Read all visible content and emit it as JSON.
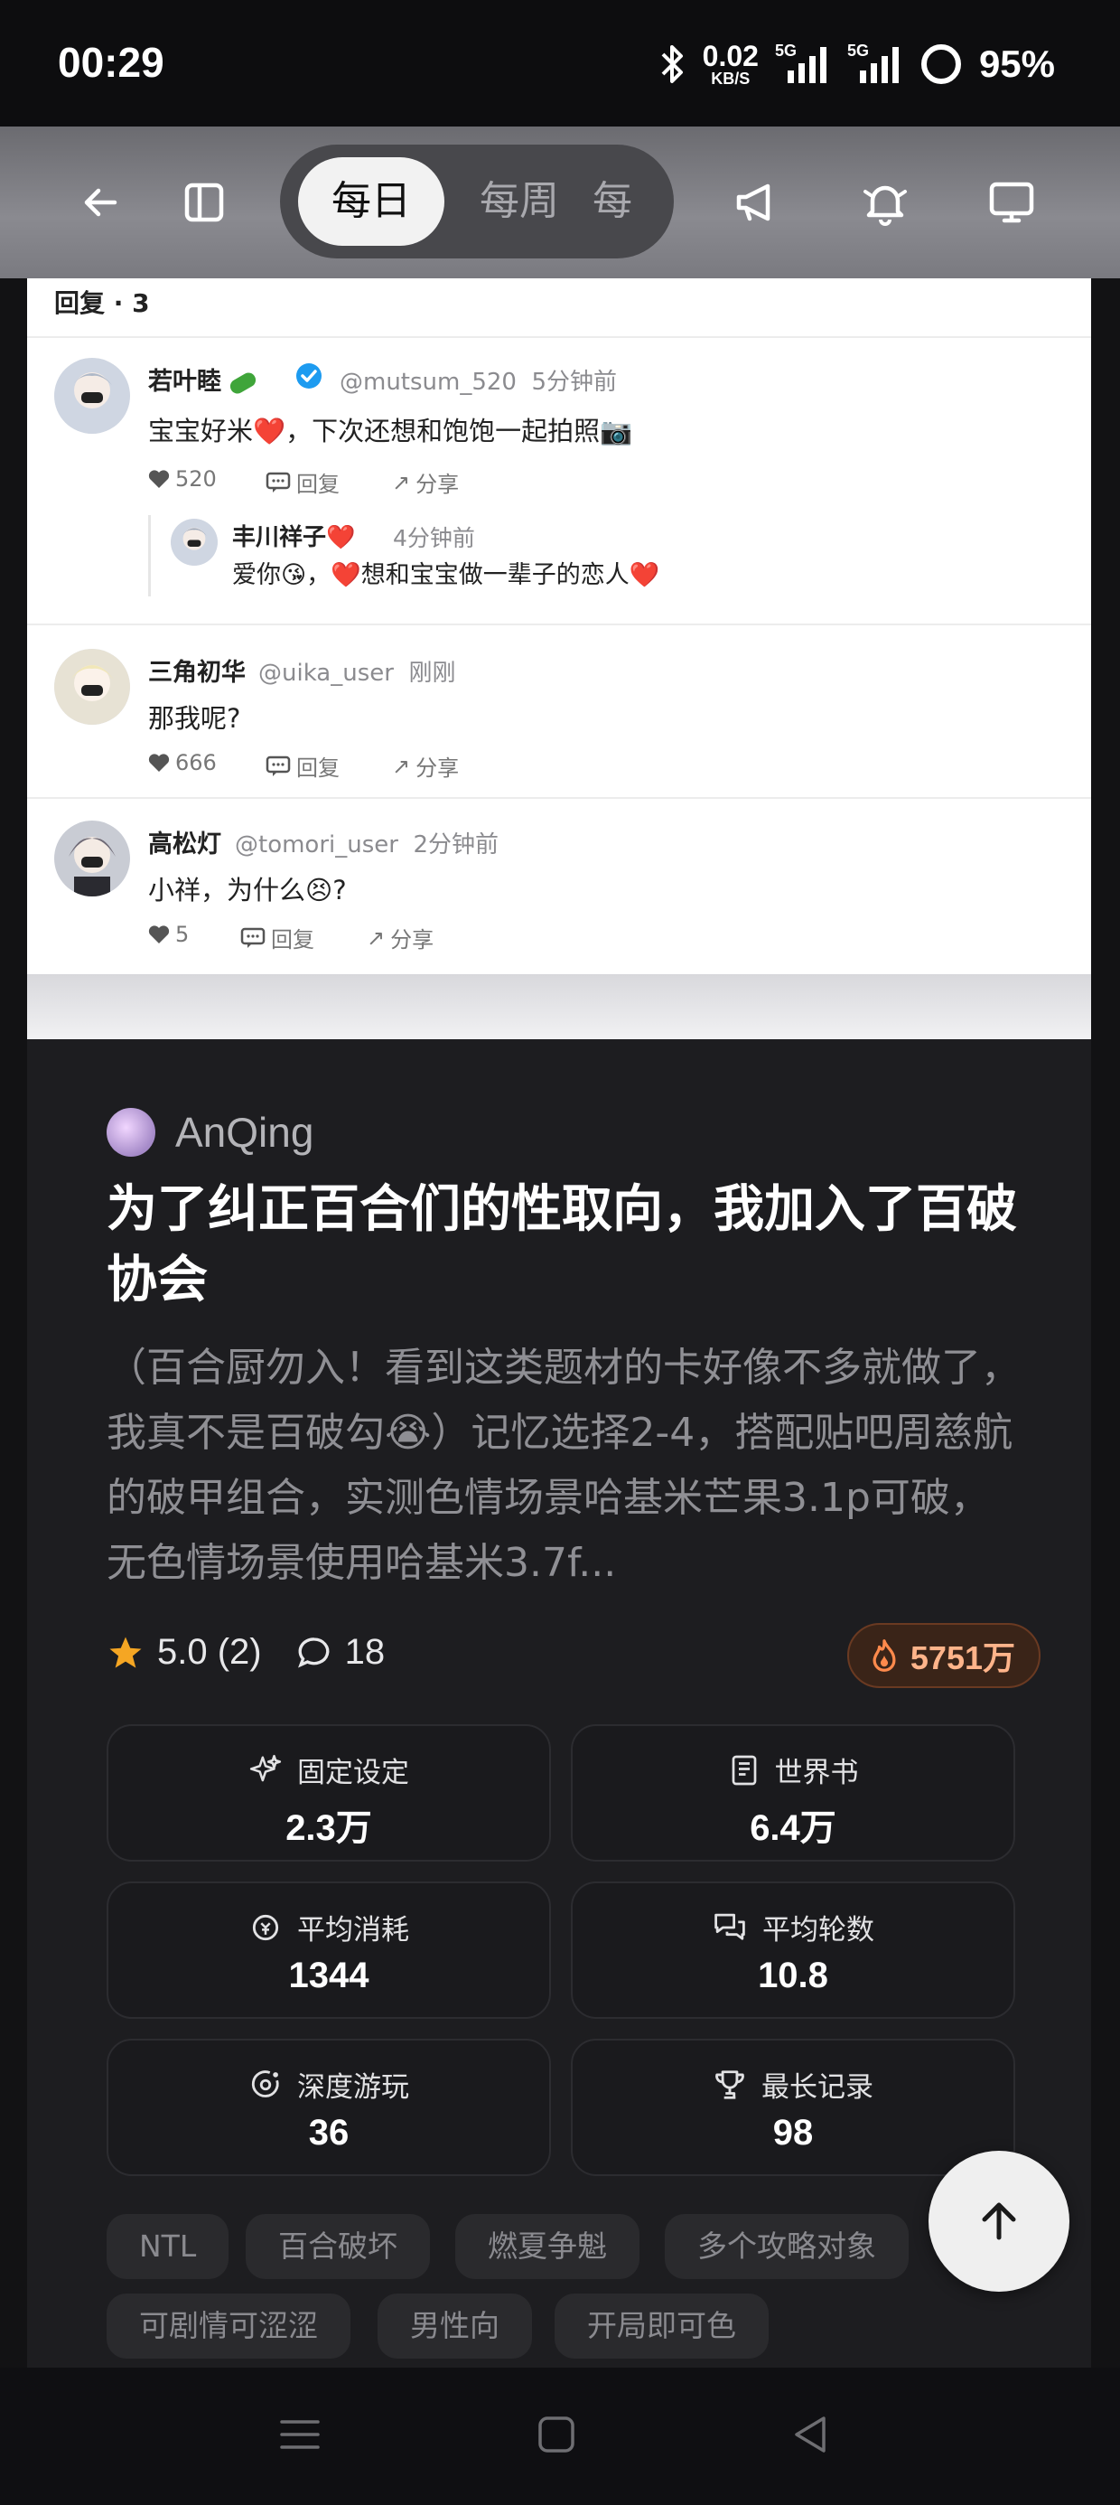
{
  "status_bar": {
    "time": "00:29",
    "net_speed": "0.02",
    "net_unit": "KB/S",
    "sig1": "5G",
    "sig2": "5G",
    "battery": "95%"
  },
  "toolbar": {
    "tabs": [
      "每日",
      "每周",
      "每"
    ],
    "active_tab": "每日"
  },
  "replies": {
    "header": "回复 · 3",
    "items": [
      {
        "name": "若叶睦",
        "handle": "@mutsum_520",
        "time": "5分钟前",
        "text": "宝宝好米❤️，下次还想和饱饱一起拍照📷",
        "likes": "520",
        "reply_label": "回复",
        "share_label": "分享",
        "nested": {
          "name": "丰川祥子❤️",
          "time": "4分钟前",
          "text": "爱你😘，❤️想和宝宝做一辈子的恋人❤️"
        }
      },
      {
        "name": "三角初华",
        "handle": "@uika_user",
        "time": "刚刚",
        "text": "那我呢?",
        "likes": "666",
        "reply_label": "回复",
        "share_label": "分享"
      },
      {
        "name": "高松灯",
        "handle": "@tomori_user",
        "time": "2分钟前",
        "text": "小祥，为什么😣?",
        "likes": "5",
        "reply_label": "回复",
        "share_label": "分享"
      }
    ]
  },
  "card": {
    "author": "AnQing",
    "title": "为了纠正百合们的性取向，我加入了百破协会",
    "description": "（百合厨勿入！看到这类题材的卡好像不多就做了，我真不是百破勾😭）记忆选择2-4，搭配贴吧周慈航的破甲组合，实测色情场景哈基米芒果3.1p可破，无色情场景使用哈基米3.7f...",
    "rating": "5.0 (2)",
    "comments": "18",
    "heat": "5751万",
    "stats": [
      {
        "label": "固定设定",
        "value": "2.3万",
        "icon": "sparkle-icon"
      },
      {
        "label": "世界书",
        "value": "6.4万",
        "icon": "book-icon"
      },
      {
        "label": "平均消耗",
        "value": "1344",
        "icon": "coin-icon"
      },
      {
        "label": "平均轮数",
        "value": "10.8",
        "icon": "chat-bubbles-icon"
      },
      {
        "label": "深度游玩",
        "value": "36",
        "icon": "orbit-icon"
      },
      {
        "label": "最长记录",
        "value": "98",
        "icon": "trophy-icon"
      }
    ],
    "tags": [
      "NTL",
      "百合破坏",
      "燃夏争魁",
      "多个攻略对象",
      "可剧情可涩涩",
      "男性向",
      "开局即可色"
    ]
  }
}
